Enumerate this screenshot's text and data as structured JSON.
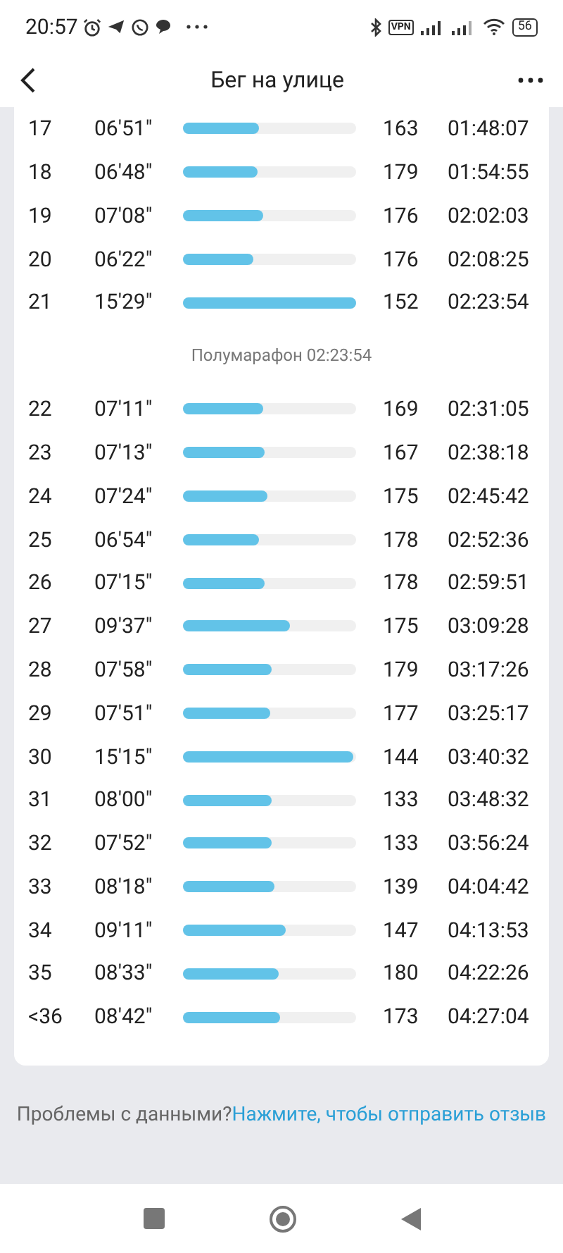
{
  "status_bar": {
    "time": "20:57",
    "vpn": "VPN",
    "battery": "56"
  },
  "header": {
    "title": "Бег на улице"
  },
  "laps_before": [
    {
      "lap": "17",
      "pace": "06'51\"",
      "level": 0.44,
      "heart_rate": "163",
      "total": "01:48:07"
    },
    {
      "lap": "18",
      "pace": "06'48\"",
      "level": 0.43,
      "heart_rate": "179",
      "total": "01:54:55"
    },
    {
      "lap": "19",
      "pace": "07'08\"",
      "level": 0.46,
      "heart_rate": "176",
      "total": "02:02:03"
    },
    {
      "lap": "20",
      "pace": "06'22\"",
      "level": 0.41,
      "heart_rate": "176",
      "total": "02:08:25"
    },
    {
      "lap": "21",
      "pace": "15'29\"",
      "level": 1.0,
      "heart_rate": "152",
      "total": "02:23:54"
    }
  ],
  "milestone": "Полумарафон 02:23:54",
  "laps_after": [
    {
      "lap": "22",
      "pace": "07'11\"",
      "level": 0.46,
      "heart_rate": "169",
      "total": "02:31:05"
    },
    {
      "lap": "23",
      "pace": "07'13\"",
      "level": 0.47,
      "heart_rate": "167",
      "total": "02:38:18"
    },
    {
      "lap": "24",
      "pace": "07'24\"",
      "level": 0.49,
      "heart_rate": "175",
      "total": "02:45:42"
    },
    {
      "lap": "25",
      "pace": "06'54\"",
      "level": 0.44,
      "heart_rate": "178",
      "total": "02:52:36"
    },
    {
      "lap": "26",
      "pace": "07'15\"",
      "level": 0.47,
      "heart_rate": "178",
      "total": "02:59:51"
    },
    {
      "lap": "27",
      "pace": "09'37\"",
      "level": 0.62,
      "heart_rate": "175",
      "total": "03:09:28"
    },
    {
      "lap": "28",
      "pace": "07'58\"",
      "level": 0.51,
      "heart_rate": "179",
      "total": "03:17:26"
    },
    {
      "lap": "29",
      "pace": "07'51\"",
      "level": 0.5,
      "heart_rate": "177",
      "total": "03:25:17"
    },
    {
      "lap": "30",
      "pace": "15'15\"",
      "level": 0.98,
      "heart_rate": "144",
      "total": "03:40:32"
    },
    {
      "lap": "31",
      "pace": "08'00\"",
      "level": 0.51,
      "heart_rate": "133",
      "total": "03:48:32"
    },
    {
      "lap": "32",
      "pace": "07'52\"",
      "level": 0.51,
      "heart_rate": "133",
      "total": "03:56:24"
    },
    {
      "lap": "33",
      "pace": "08'18\"",
      "level": 0.53,
      "heart_rate": "139",
      "total": "04:04:42"
    },
    {
      "lap": "34",
      "pace": "09'11\"",
      "level": 0.59,
      "heart_rate": "147",
      "total": "04:13:53"
    },
    {
      "lap": "35",
      "pace": "08'33\"",
      "level": 0.55,
      "heart_rate": "180",
      "total": "04:22:26"
    },
    {
      "lap": "<36",
      "pace": "08'42\"",
      "level": 0.56,
      "heart_rate": "173",
      "total": "04:27:04"
    }
  ],
  "footer": {
    "text": "Проблемы с данными?",
    "link": "Нажмите, чтобы отправить отзыв"
  }
}
